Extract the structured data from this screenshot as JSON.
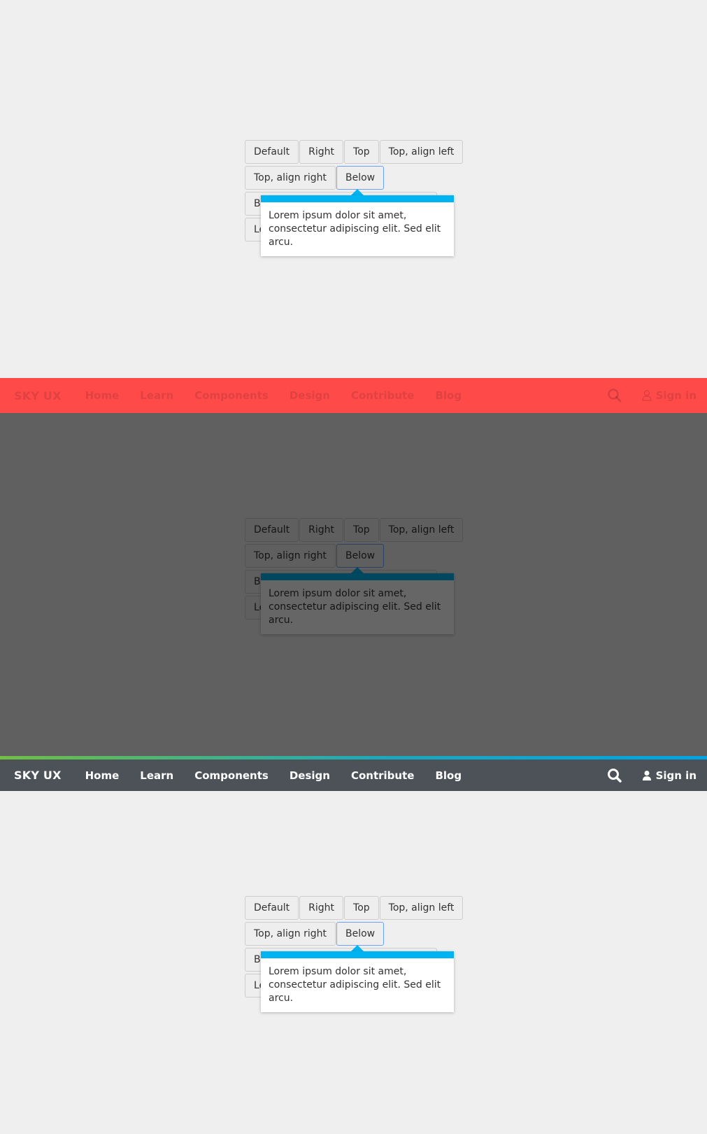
{
  "buttons_row1": [
    "Default",
    "Right",
    "Top",
    "Top, align left"
  ],
  "buttons_row2": [
    "Top, align right",
    "Below"
  ],
  "popover_text": "Lorem ipsum dolor sit amet, consectetur adipiscing elit. Sed elit arcu.",
  "hidden_btn_row3": "B",
  "hidden_btn_row4": "Le",
  "navbar": {
    "brand": "SKY UX",
    "links": [
      "Home",
      "Learn",
      "Components",
      "Design",
      "Contribute",
      "Blog"
    ],
    "sign_in": "Sign in"
  },
  "colors": {
    "popover_accent": "#00b4f1",
    "navbar_alert": "#ff4a4a",
    "navbar_dark": "#4d5259"
  }
}
